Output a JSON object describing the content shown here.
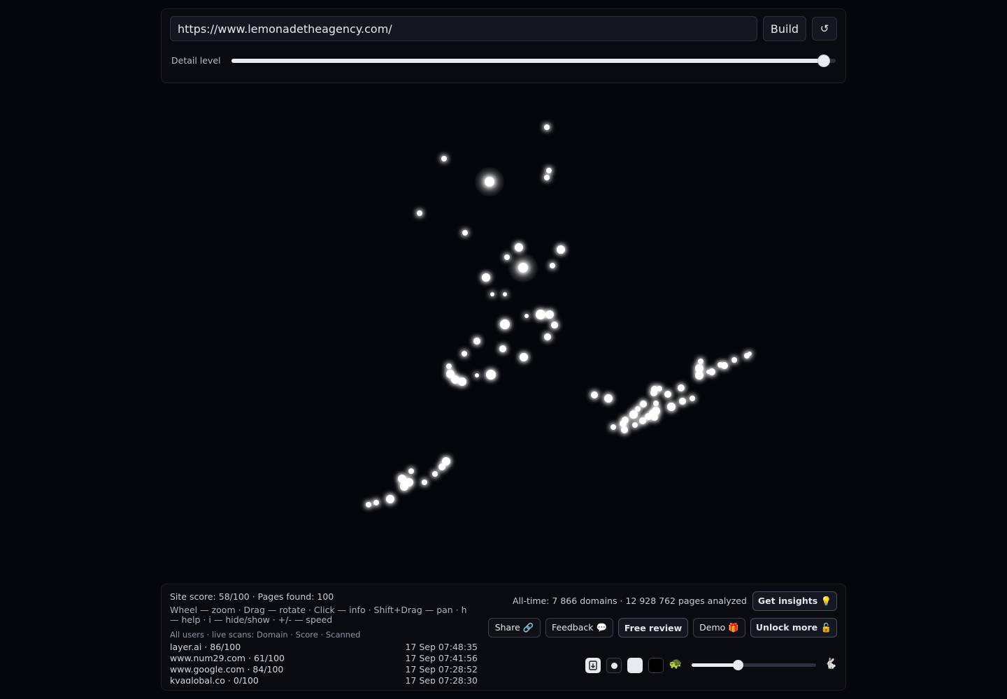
{
  "toolbar": {
    "url_value": "https://www.lemonadetheagency.com/",
    "build_label": "Build",
    "reload_icon": "↺",
    "detail_label": "Detail level",
    "detail_level": 0.98
  },
  "graph": {
    "node_color": "#ffffff",
    "background": "#05060a"
  },
  "footer": {
    "site_score": "Site score: 58/100 · Pages found: 100",
    "help_text": "Wheel — zoom · Drag — rotate · Click — info · Shift+Drag — pan · h — help · i — hide/show · +/- — speed",
    "live_header": "All users · live scans: Domain · Score · Scanned",
    "live_scans": [
      {
        "domain": "layer.ai · 86/100",
        "scanned": "17 Sep 07:48:35"
      },
      {
        "domain": "www.num29.com · 61/100",
        "scanned": "17 Sep 07:41:56"
      },
      {
        "domain": "www.google.com · 84/100",
        "scanned": "17 Sep 07:28:52"
      },
      {
        "domain": "kvaglobal.co · 0/100",
        "scanned": "17 Sep 07:28:30"
      }
    ],
    "alltime": "All-time: 7 866 domains · 12 928 762 pages analyzed",
    "get_insights": "Get insights 💡",
    "share": "Share 🔗",
    "feedback": "Feedback 💬",
    "free_review": "Free review",
    "demo": "Demo 🎁",
    "unlock_more": "Unlock more 🔓",
    "speed_slow_icon": "🐢",
    "speed_fast_icon": "🐇",
    "speed_level": 0.37
  }
}
